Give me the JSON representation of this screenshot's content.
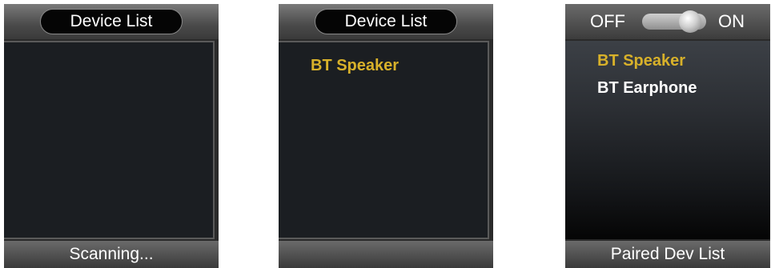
{
  "screens": [
    {
      "title": "Device List",
      "items": [],
      "footer": "Scanning..."
    },
    {
      "title": "Device List",
      "items": [
        {
          "label": "BT Speaker",
          "state": "selected"
        }
      ],
      "footer": ""
    },
    {
      "toggle": {
        "off_label": "OFF",
        "on_label": "ON",
        "state": "on"
      },
      "items": [
        {
          "label": "BT Speaker",
          "state": "selected"
        },
        {
          "label": "BT Earphone",
          "state": "normal"
        }
      ],
      "footer": "Paired Dev List"
    }
  ],
  "colors": {
    "selected": "#d8b12a",
    "normal": "#ffffff"
  }
}
